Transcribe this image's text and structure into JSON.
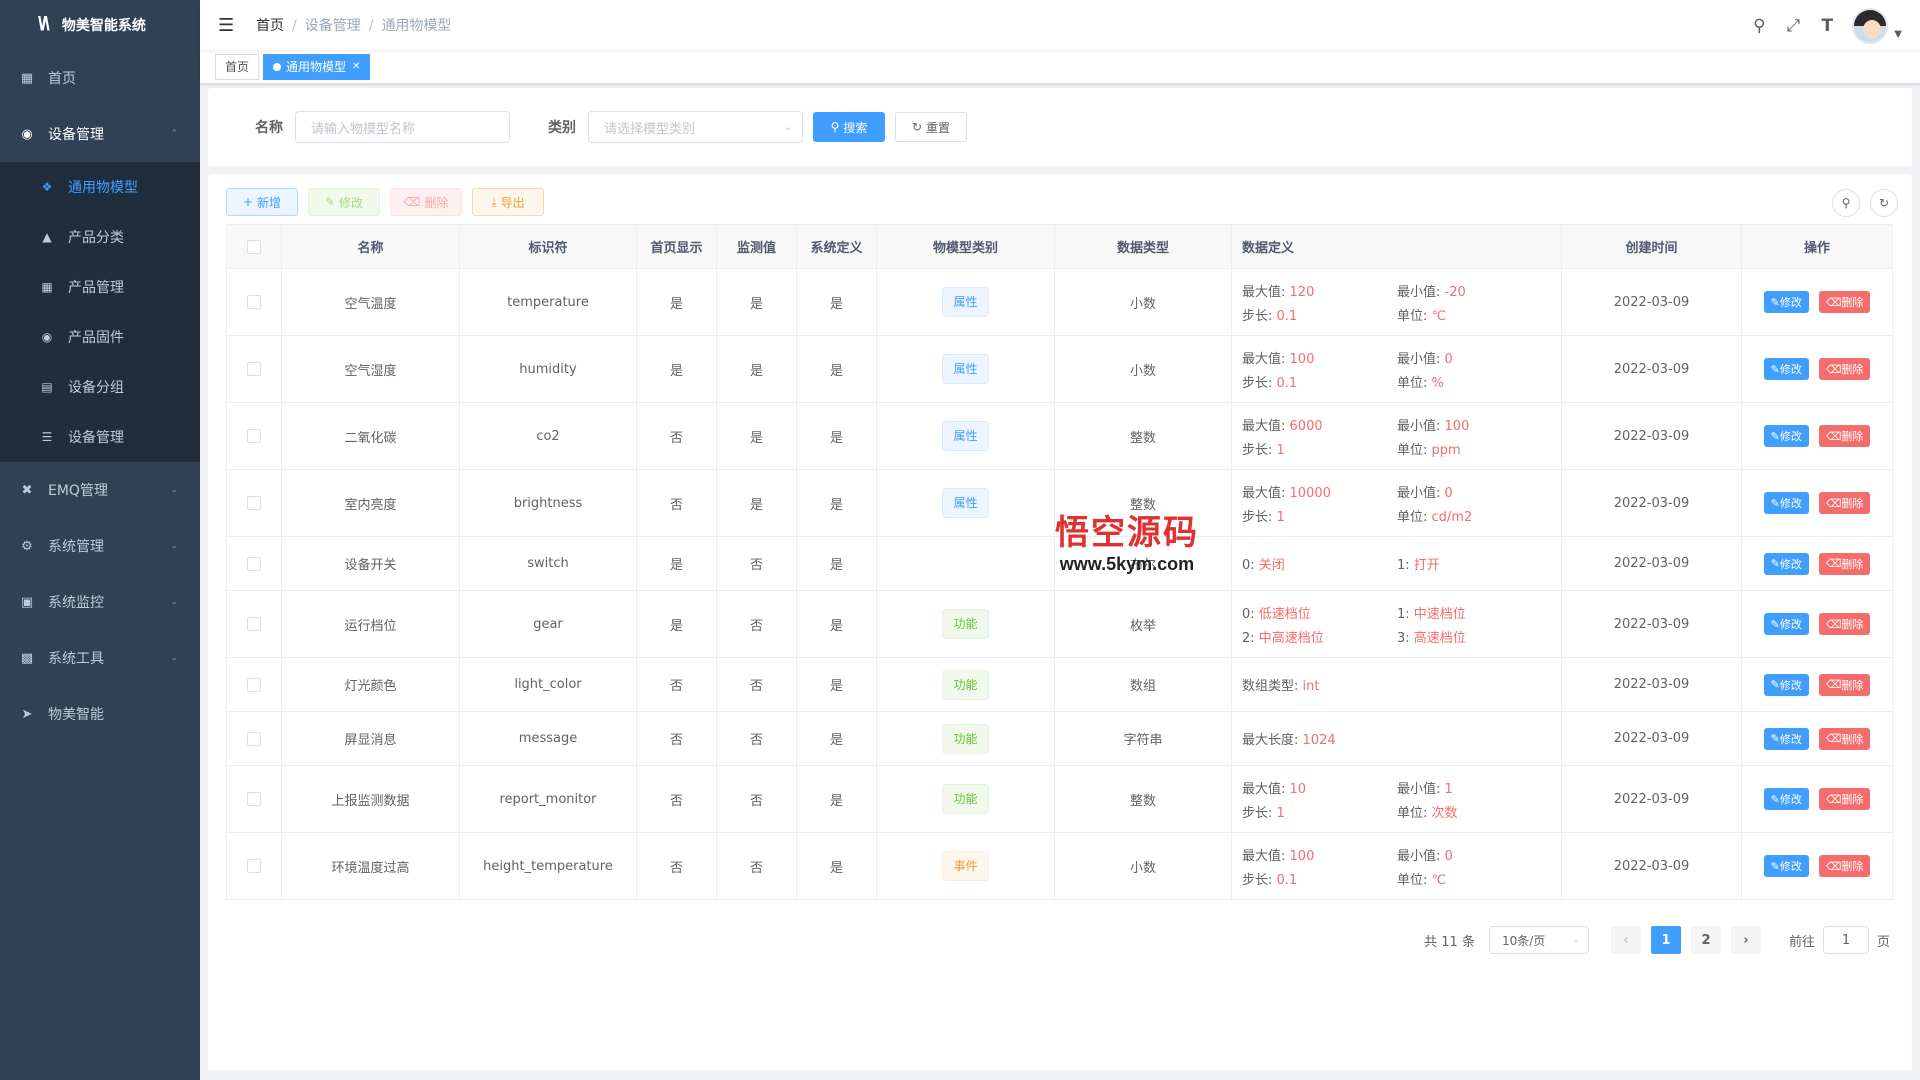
{
  "brand": {
    "logo": "W",
    "name": "物美智能系统"
  },
  "sidebar": {
    "items": [
      {
        "icon": "dashboard-icon",
        "label": "首页"
      },
      {
        "icon": "device-icon",
        "label": "设备管理",
        "open": true,
        "children": [
          {
            "icon": "cube-icon",
            "label": "通用物模型",
            "active": true
          },
          {
            "icon": "tree-icon",
            "label": "产品分类"
          },
          {
            "icon": "grid-icon",
            "label": "产品管理"
          },
          {
            "icon": "firmware-icon",
            "label": "产品固件"
          },
          {
            "icon": "group-icon",
            "label": "设备分组"
          },
          {
            "icon": "list-icon",
            "label": "设备管理"
          }
        ]
      },
      {
        "icon": "tool-icon",
        "label": "EMQ管理"
      },
      {
        "icon": "gear-icon",
        "label": "系统管理"
      },
      {
        "icon": "monitor-icon",
        "label": "系统监控"
      },
      {
        "icon": "toolbox-icon",
        "label": "系统工具"
      },
      {
        "icon": "send-icon",
        "label": "物美智能"
      }
    ]
  },
  "breadcrumb": [
    "首页",
    "设备管理",
    "通用物模型"
  ],
  "tags": [
    {
      "label": "首页",
      "active": false
    },
    {
      "label": "通用物模型",
      "active": true
    }
  ],
  "search": {
    "name_label": "名称",
    "name_placeholder": "请输入物模型名称",
    "type_label": "类别",
    "type_placeholder": "请选择模型类别",
    "search_btn": "搜索",
    "reset_btn": "重置"
  },
  "toolbar": {
    "add": "新增",
    "edit": "修改",
    "delete": "删除",
    "export": "导出"
  },
  "table": {
    "columns": [
      "名称",
      "标识符",
      "首页显示",
      "监测值",
      "系统定义",
      "物模型类别",
      "数据类型",
      "数据定义",
      "创建时间",
      "操作"
    ],
    "edit_label": "修改",
    "delete_label": "删除",
    "rows": [
      {
        "name": "空气温度",
        "ident": "temperature",
        "home": "是",
        "monitor": "是",
        "sys": "是",
        "cat": "属性",
        "cat_type": "attr",
        "dtype": "小数",
        "def": [
          [
            "最大值:",
            "120"
          ],
          [
            "最小值:",
            "-20"
          ],
          [
            "步长:",
            "0.1"
          ],
          [
            "单位:",
            "℃"
          ]
        ],
        "time": "2022-03-09"
      },
      {
        "name": "空气湿度",
        "ident": "humidity",
        "home": "是",
        "monitor": "是",
        "sys": "是",
        "cat": "属性",
        "cat_type": "attr",
        "dtype": "小数",
        "def": [
          [
            "最大值:",
            "100"
          ],
          [
            "最小值:",
            "0"
          ],
          [
            "步长:",
            "0.1"
          ],
          [
            "单位:",
            "%"
          ]
        ],
        "time": "2022-03-09"
      },
      {
        "name": "二氧化碳",
        "ident": "co2",
        "home": "否",
        "monitor": "是",
        "sys": "是",
        "cat": "属性",
        "cat_type": "attr",
        "dtype": "整数",
        "def": [
          [
            "最大值:",
            "6000"
          ],
          [
            "最小值:",
            "100"
          ],
          [
            "步长:",
            "1"
          ],
          [
            "单位:",
            "ppm"
          ]
        ],
        "time": "2022-03-09"
      },
      {
        "name": "室内亮度",
        "ident": "brightness",
        "home": "否",
        "monitor": "是",
        "sys": "是",
        "cat": "属性",
        "cat_type": "attr",
        "dtype": "整数",
        "def": [
          [
            "最大值:",
            "10000"
          ],
          [
            "最小值:",
            "0"
          ],
          [
            "步长:",
            "1"
          ],
          [
            "单位:",
            "cd/m2"
          ]
        ],
        "time": "2022-03-09"
      },
      {
        "name": "设备开关",
        "ident": "switch",
        "home": "是",
        "monitor": "否",
        "sys": "是",
        "cat": "",
        "cat_type": "",
        "dtype": "布尔",
        "def": [
          [
            "0:",
            "关闭"
          ],
          [
            "1:",
            "打开"
          ]
        ],
        "time": "2022-03-09"
      },
      {
        "name": "运行档位",
        "ident": "gear",
        "home": "是",
        "monitor": "否",
        "sys": "是",
        "cat": "功能",
        "cat_type": "func",
        "dtype": "枚举",
        "def": [
          [
            "0:",
            "低速档位"
          ],
          [
            "1:",
            "中速档位"
          ],
          [
            "2:",
            "中高速档位"
          ],
          [
            "3:",
            "高速档位"
          ]
        ],
        "time": "2022-03-09"
      },
      {
        "name": "灯光颜色",
        "ident": "light_color",
        "home": "否",
        "monitor": "否",
        "sys": "是",
        "cat": "功能",
        "cat_type": "func",
        "dtype": "数组",
        "def": [
          [
            "数组类型:",
            "int"
          ]
        ],
        "time": "2022-03-09"
      },
      {
        "name": "屏显消息",
        "ident": "message",
        "home": "否",
        "monitor": "否",
        "sys": "是",
        "cat": "功能",
        "cat_type": "func",
        "dtype": "字符串",
        "def": [
          [
            "最大长度:",
            "1024"
          ]
        ],
        "time": "2022-03-09"
      },
      {
        "name": "上报监测数据",
        "ident": "report_monitor",
        "home": "否",
        "monitor": "否",
        "sys": "是",
        "cat": "功能",
        "cat_type": "func",
        "dtype": "整数",
        "def": [
          [
            "最大值:",
            "10"
          ],
          [
            "最小值:",
            "1"
          ],
          [
            "步长:",
            "1"
          ],
          [
            "单位:",
            "次数"
          ]
        ],
        "time": "2022-03-09"
      },
      {
        "name": "环境温度过高",
        "ident": "height_temperature",
        "home": "否",
        "monitor": "否",
        "sys": "是",
        "cat": "事件",
        "cat_type": "event",
        "dtype": "小数",
        "def": [
          [
            "最大值:",
            "100"
          ],
          [
            "最小值:",
            "0"
          ],
          [
            "步长:",
            "0.1"
          ],
          [
            "单位:",
            "℃"
          ]
        ],
        "time": "2022-03-09"
      }
    ]
  },
  "pagination": {
    "total": "共 11 条",
    "page_size": "10条/页",
    "pages": [
      "1",
      "2"
    ],
    "current": "1",
    "goto_label": "前往",
    "goto_value": "1",
    "page_suffix": "页"
  },
  "watermark": {
    "title": "悟空源码",
    "url": "www.5kym.com"
  }
}
